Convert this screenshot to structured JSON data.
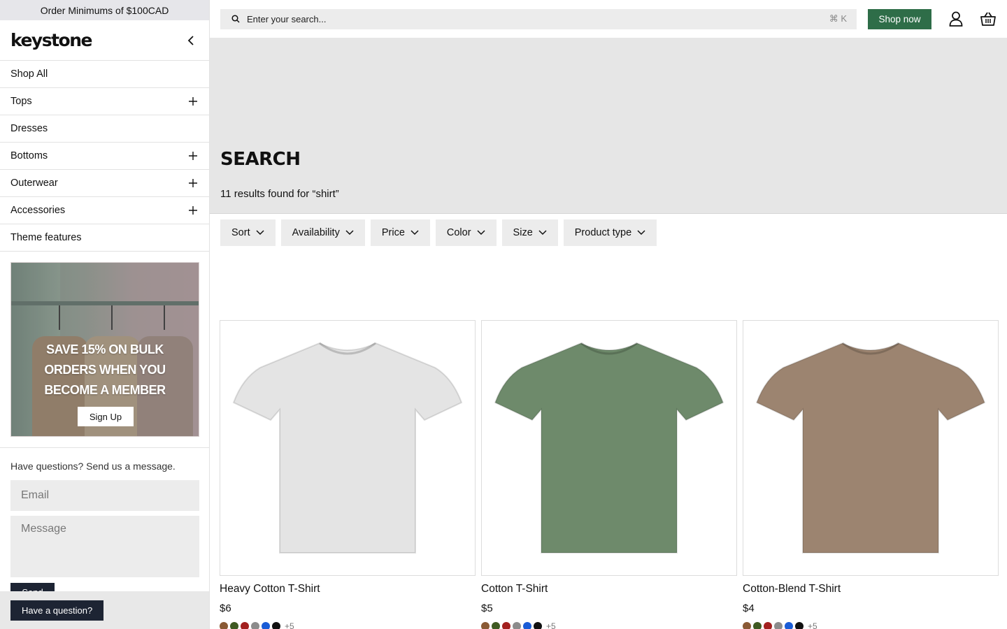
{
  "announcement": "Order Minimums of $100CAD",
  "brand": "keystone",
  "nav": [
    {
      "label": "Shop All",
      "expandable": false
    },
    {
      "label": "Tops",
      "expandable": true
    },
    {
      "label": "Dresses",
      "expandable": false
    },
    {
      "label": "Bottoms",
      "expandable": true
    },
    {
      "label": "Outerwear",
      "expandable": true
    },
    {
      "label": "Accessories",
      "expandable": true
    },
    {
      "label": "Theme features",
      "expandable": false
    }
  ],
  "promo": {
    "title_lines": [
      "SAVE 15% ON BULK",
      "ORDERS WHEN YOU",
      "BECOME A MEMBER"
    ],
    "button": "Sign Up"
  },
  "contact": {
    "title": "Have questions? Send us a message.",
    "email_placeholder": "Email",
    "message_placeholder": "Message",
    "send_label": "Send"
  },
  "question_button": "Have a question?",
  "header": {
    "search_placeholder": "Enter your search...",
    "search_shortcut": "⌘ K",
    "shop_now": "Shop now"
  },
  "hero": {
    "title": "SEARCH",
    "result_text": "11 results found for “shirt”"
  },
  "filters": [
    "Sort",
    "Availability",
    "Price",
    "Color",
    "Size",
    "Product type"
  ],
  "products": [
    {
      "title": "Heavy Cotton T-Shirt",
      "price": "$6",
      "shirt_color": "#e4e4e4",
      "more": "+5"
    },
    {
      "title": "Cotton T-Shirt",
      "price": "$5",
      "shirt_color": "#6e8a6b",
      "more": "+5"
    },
    {
      "title": "Cotton-Blend T-Shirt",
      "price": "$4",
      "shirt_color": "#9c8470",
      "more": "+5"
    }
  ],
  "swatch_colors": [
    "#8a5a35",
    "#3f5a22",
    "#a3201f",
    "#8c8c8c",
    "#1a5cd6",
    "#111111"
  ],
  "colors": {
    "accent": "#2e6d48",
    "dark": "#1d2433"
  }
}
